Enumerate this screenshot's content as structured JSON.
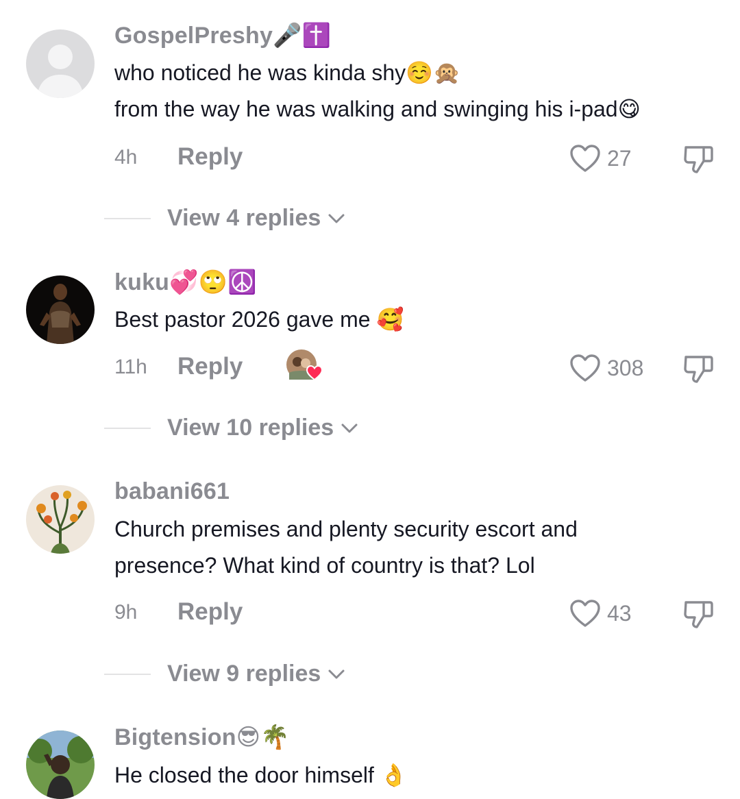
{
  "comments": [
    {
      "username": "GospelPreshy🎤✝️",
      "lines": [
        "who noticed he was kinda shy☺️🙊",
        "from the way he was walking and swinging his i-pad😋"
      ],
      "time": "4h",
      "reply_label": "Reply",
      "likes": "27",
      "view_replies": "View 4 replies"
    },
    {
      "username": "kuku💞🙄☮️",
      "lines": [
        "Best pastor 2026 gave me 🥰"
      ],
      "time": "11h",
      "reply_label": "Reply",
      "likes": "308",
      "view_replies": "View 10 replies"
    },
    {
      "username": "babani661",
      "lines": [
        "Church premises and plenty security escort and",
        "presence? What kind of country is that? Lol"
      ],
      "time": "9h",
      "reply_label": "Reply",
      "likes": "43",
      "view_replies": "View 9 replies"
    },
    {
      "username": "Bigtension😎🌴",
      "lines": [
        "He closed the door himself 👌"
      ]
    }
  ],
  "icons": {
    "like": "heart-outline-icon",
    "dislike": "thumbs-down-icon",
    "expand": "chevron-down-icon",
    "creator_liked": "heart-badge-icon"
  },
  "colors": {
    "muted_text": "#8a8b91",
    "primary_text": "#161823",
    "heart_badge": "#fe2c55"
  }
}
